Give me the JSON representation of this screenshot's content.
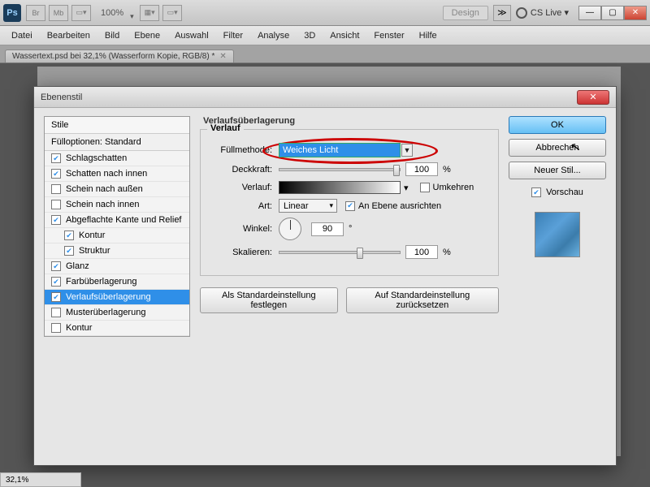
{
  "appbar": {
    "zoom": "100%",
    "design": "Design",
    "cslive": "CS Live ▾"
  },
  "menu": [
    "Datei",
    "Bearbeiten",
    "Bild",
    "Ebene",
    "Auswahl",
    "Filter",
    "Analyse",
    "3D",
    "Ansicht",
    "Fenster",
    "Hilfe"
  ],
  "tab": {
    "label": "Wassertext.psd bei 32,1% (Wasserform Kopie, RGB/8) *"
  },
  "dialog": {
    "title": "Ebenenstil",
    "styles_header": "Stile",
    "fill_opts": "Fülloptionen: Standard",
    "items": [
      {
        "label": "Schlagschatten",
        "on": true
      },
      {
        "label": "Schatten nach innen",
        "on": true
      },
      {
        "label": "Schein nach außen",
        "on": false
      },
      {
        "label": "Schein nach innen",
        "on": false
      },
      {
        "label": "Abgeflachte Kante und Relief",
        "on": true
      },
      {
        "label": "Kontur",
        "on": true,
        "indent": true
      },
      {
        "label": "Struktur",
        "on": true,
        "indent": true
      },
      {
        "label": "Glanz",
        "on": true
      },
      {
        "label": "Farbüberlagerung",
        "on": true
      },
      {
        "label": "Verlaufsüberlagerung",
        "on": true,
        "sel": true
      },
      {
        "label": "Musterüberlagerung",
        "on": false
      },
      {
        "label": "Kontur",
        "on": false
      }
    ],
    "section": "Verlaufsüberlagerung",
    "group": "Verlauf",
    "labels": {
      "blend": "Füllmethode:",
      "opacity": "Deckkraft:",
      "gradient": "Verlauf:",
      "reverse": "Umkehren",
      "style": "Art:",
      "align": "An Ebene ausrichten",
      "angle": "Winkel:",
      "scale": "Skalieren:"
    },
    "values": {
      "blend": "Weiches Licht",
      "opacity": "100",
      "pct": "%",
      "style": "Linear",
      "angle": "90",
      "deg": "°",
      "scale": "100"
    },
    "buttons": {
      "default": "Als Standardeinstellung festlegen",
      "reset": "Auf Standardeinstellung zurücksetzen"
    },
    "right": {
      "ok": "OK",
      "cancel": "Abbrechen",
      "newstyle": "Neuer Stil...",
      "preview": "Vorschau"
    }
  },
  "status": "32,1%"
}
